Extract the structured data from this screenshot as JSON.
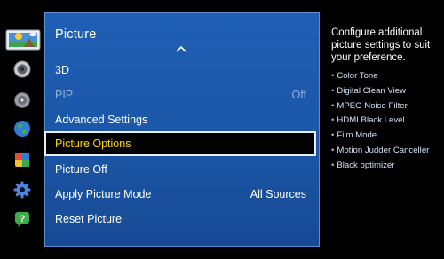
{
  "sidebar": {
    "items": [
      {
        "icon": "picture-icon",
        "selected": true
      },
      {
        "icon": "sound-icon",
        "selected": false
      },
      {
        "icon": "broadcast-icon",
        "selected": false
      },
      {
        "icon": "network-icon",
        "selected": false
      },
      {
        "icon": "smart-features-icon",
        "selected": false
      },
      {
        "icon": "system-gear-icon",
        "selected": false
      },
      {
        "icon": "support-icon",
        "selected": false
      }
    ]
  },
  "panel": {
    "title": "Picture",
    "items": [
      {
        "label": "3D",
        "value": ""
      },
      {
        "label": "PIP",
        "value": "Off",
        "disabled": true
      },
      {
        "label": "Advanced Settings",
        "value": ""
      },
      {
        "label": "Picture Options",
        "value": "",
        "selected": true
      },
      {
        "label": "Picture Off",
        "value": ""
      },
      {
        "label": "Apply Picture Mode",
        "value": "All Sources"
      },
      {
        "label": "Reset Picture",
        "value": ""
      }
    ]
  },
  "help": {
    "description": "Configure additional picture settings to suit your preference.",
    "bullet": "•",
    "items": [
      "Color Tone",
      "Digital Clean View",
      "MPEG Noise Filter",
      "HDMI Black Level",
      "Film Mode",
      "Motion Judder Canceller",
      "Black optimizer"
    ]
  },
  "colors": {
    "panel_blue": "#1c58aa",
    "selected_text": "#ffd60a",
    "disabled_text": "#8fb0dc"
  }
}
